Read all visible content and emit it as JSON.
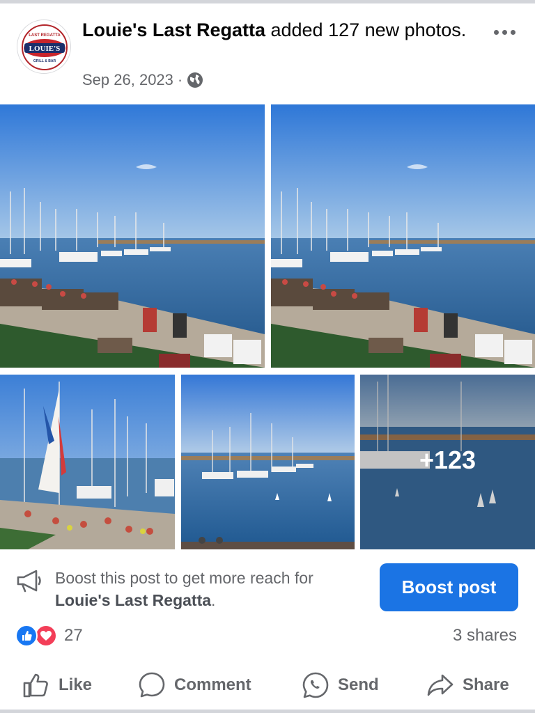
{
  "post": {
    "page_name": "Louie's Last Regatta",
    "action_text": " added 127 new photos.",
    "date": "Sep 26, 2023",
    "separator": "·",
    "privacy_icon": "globe-icon",
    "more_icon": "more-horizontal-icon"
  },
  "avatar": {
    "logo_top_text": "LAST REGATTA",
    "logo_main_text": "LOUIE'S",
    "logo_bottom_text": "GRILL & BAR"
  },
  "photos": {
    "count": 5,
    "more_overlay": "+123"
  },
  "boost": {
    "prompt": "Boost this post to get more reach for ",
    "page_name": "Louie's Last Regatta",
    "end": ".",
    "button_label": "Boost post",
    "icon": "megaphone-icon"
  },
  "engagement": {
    "reaction_icons": [
      "like-reaction-icon",
      "love-reaction-icon"
    ],
    "reaction_count": "27",
    "shares": "3 shares"
  },
  "actions": {
    "like": "Like",
    "comment": "Comment",
    "send": "Send",
    "share": "Share"
  },
  "colors": {
    "accent": "#1b74e4",
    "like_blue": "#1877f2",
    "love_red": "#f33e58",
    "secondary_text": "#65676b"
  }
}
